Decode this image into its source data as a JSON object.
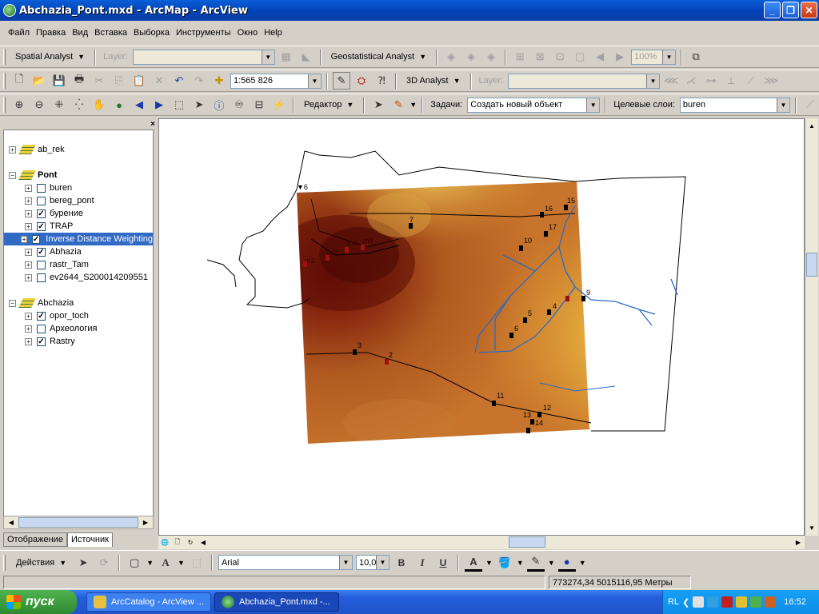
{
  "window": {
    "title": "Abchazia_Pont.mxd - ArcMap - ArcView"
  },
  "menu": [
    "Файл",
    "Правка",
    "Вид",
    "Вставка",
    "Выборка",
    "Инструменты",
    "Окно",
    "Help"
  ],
  "toolbar1": {
    "spatial_analyst": "Spatial Analyst",
    "layer_label": "Layer:",
    "geostat": "Geostatistical Analyst",
    "zoom_percent": "100%"
  },
  "toolbar2": {
    "scale": "1:565 826",
    "analyst3d": "3D Analyst",
    "layer_label": "Layer:"
  },
  "toolbar3": {
    "editor": "Редактор",
    "task_label": "Задачи:",
    "task_value": "Создать новый объект",
    "target_label": "Целевые слои:",
    "target_value": "buren"
  },
  "toc": {
    "close": "×",
    "items": [
      {
        "label": "ab_rek",
        "group": true,
        "expand": "+"
      },
      {
        "label": "Pont",
        "group": true,
        "bold": true,
        "expand": "−"
      },
      {
        "label": "buren",
        "checked": false,
        "expand": "+"
      },
      {
        "label": "bereg_pont",
        "checked": false,
        "expand": "+"
      },
      {
        "label": "бурение",
        "checked": true,
        "expand": "+"
      },
      {
        "label": "TRAP",
        "checked": true,
        "expand": "+"
      },
      {
        "label": "Inverse Distance Weighting",
        "checked": true,
        "selected": true,
        "expand": "+"
      },
      {
        "label": "Abhazia",
        "checked": true,
        "expand": "+"
      },
      {
        "label": "rastr_Tam",
        "checked": false,
        "expand": "+"
      },
      {
        "label": "ev2644_S200014209551",
        "checked": false,
        "expand": "+"
      },
      {
        "label": "Abchazia",
        "group": true,
        "expand": "−"
      },
      {
        "label": "opor_toch",
        "checked": true,
        "expand": "+"
      },
      {
        "label": "Археология",
        "checked": false,
        "expand": "+"
      },
      {
        "label": "Rastry",
        "checked": true,
        "expand": "+"
      }
    ],
    "tabs": [
      "Отображение",
      "Источник"
    ]
  },
  "map": {
    "points": [
      {
        "id": "2",
        "color": "#a01010"
      },
      {
        "id": "3",
        "color": "#000"
      },
      {
        "id": "4",
        "color": "#000"
      },
      {
        "id": "5",
        "color": "#000"
      },
      {
        "id": "6",
        "color": "#000"
      },
      {
        "id": "7",
        "color": "#000"
      },
      {
        "id": "8",
        "color": "#000"
      },
      {
        "id": "9",
        "color": "#000"
      },
      {
        "id": "10",
        "color": "#000"
      },
      {
        "id": "11",
        "color": "#000"
      },
      {
        "id": "12",
        "color": "#000"
      },
      {
        "id": "13",
        "color": "#000"
      },
      {
        "id": "14",
        "color": "#000"
      },
      {
        "id": "15",
        "color": "#000"
      },
      {
        "id": "16",
        "color": "#000"
      },
      {
        "id": "17",
        "color": "#000"
      },
      {
        "id": "m1",
        "color": "#a01010"
      },
      {
        "id": "m2",
        "color": "#a01010"
      },
      {
        "id": "m3",
        "color": "#a01010"
      },
      {
        "id": "m4",
        "color": "#a01010"
      },
      {
        "id": "4",
        "color": "#a01010"
      }
    ]
  },
  "drawbar": {
    "actions": "Действия",
    "font": "Arial",
    "size": "10,00",
    "bold": "B",
    "italic": "I",
    "underline": "U"
  },
  "status": {
    "coords": "773274,34  5015116,95 Метры"
  },
  "taskbar": {
    "start": "пуск",
    "tasks": [
      "ArcCatalog - ArcView ...",
      "Abchazia_Pont.mxd -..."
    ],
    "lang": "RL",
    "clock": "16:52"
  }
}
